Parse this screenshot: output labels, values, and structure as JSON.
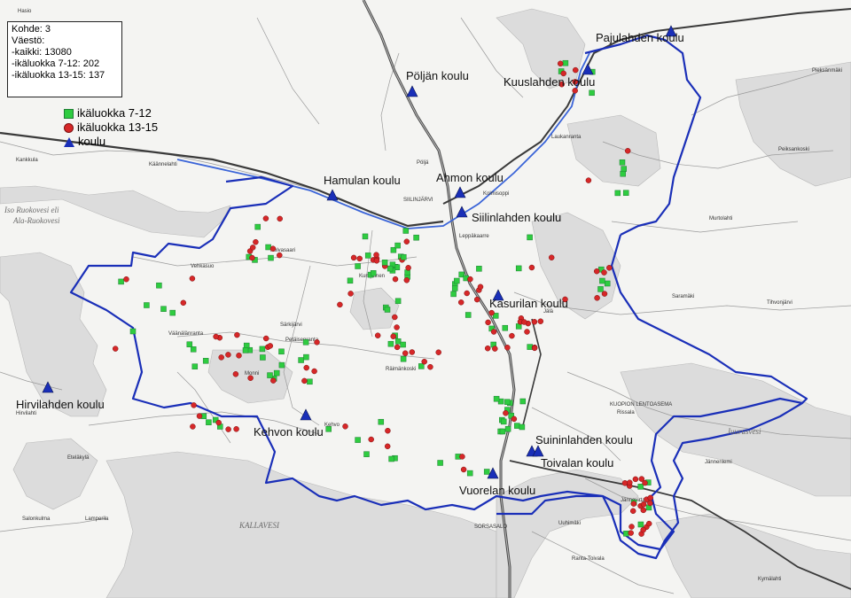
{
  "info": {
    "line1": "Kohde: 3",
    "line2": "Väestö:",
    "line3": "-kaikki: 13080",
    "line4": "-ikäluokka 7-12: 202",
    "line5": "-ikäluokka 13-15: 137"
  },
  "legend": {
    "item1": "ikäluokka 7-12",
    "item2": "ikäluokka 13-15",
    "item3": "koulu"
  },
  "colors": {
    "age7_12": "#2ecc40",
    "age13_15": "#d62728",
    "school": "#1a2fb8",
    "boundary": "#1a2fb8",
    "water": "#dcdcdc",
    "road": "#3a3a3a"
  },
  "schools": [
    {
      "name": "Pajulahden koulu"
    },
    {
      "name": "Pöljän koulu"
    },
    {
      "name": "Kuuslahden koulu"
    },
    {
      "name": "Hamulan koulu"
    },
    {
      "name": "Ahmon koulu"
    },
    {
      "name": "Siilinlahden koulu"
    },
    {
      "name": "Kasurilan koulu"
    },
    {
      "name": "Hirvilahden koulu"
    },
    {
      "name": "Kehvon koulu"
    },
    {
      "name": "Suininlahden koulu"
    },
    {
      "name": "Toivalan koulu"
    },
    {
      "name": "Vuorelan koulu"
    }
  ],
  "places": {
    "haisio": "Hasio",
    "poljan_small": "Pöljä",
    "siilinjarvi": "SIILINJÄRVI",
    "kolmisoppi": "Kolmisoppi",
    "leppakaarre": "Leppäkaarre",
    "vehkasuo": "Vehkasuo",
    "kolvasaari": "Kolvasaari",
    "kumpunen": "Kumpunen",
    "vaanalanranta": "Väänälänranta",
    "petalisenranta": "Petäisenranta",
    "sarkijarvi": "Särkijärvi",
    "monni": "Monni",
    "raimankoski": "Räimänkoski",
    "kehvo": "Kehvo",
    "kuopion_lentoasema": "KUOPION LENTOASEMA",
    "rissala": "Rissala",
    "jannevirta": "Jännevirta",
    "uuhimaki": "Uuhimäki",
    "ranta_toivala": "Ranta-Toivala",
    "sorsasalo": "SORSASALO",
    "murtolahti": "Murtolahti",
    "saramaki": "Saramäki",
    "tihvonjarvi": "Tihvonjärvi",
    "laukanranta": "Laukanranta",
    "kankkula": "Kankkula",
    "kaannelahti": "Käännelahti",
    "hirvilahti": "Hirvilahti",
    "etelakyla": "Eteläkylä",
    "salonkulma": "Salonkulma",
    "lamperila": "Lamperila",
    "peiksankoski": "Peiksankoski",
    "pieksanmaki": "Pieksänmäki",
    "jannenlemi": "Jännenlemi",
    "kymalahti": "Kymälahti",
    "jala": "Jälä"
  },
  "water_labels": {
    "ruokovesi": "Ala-Ruokovesi",
    "iso_ruokovesi": "Iso Ruokovesi eli",
    "kallavesi": "KALLAVESI",
    "juurusvesi": "Juurusvesi"
  }
}
